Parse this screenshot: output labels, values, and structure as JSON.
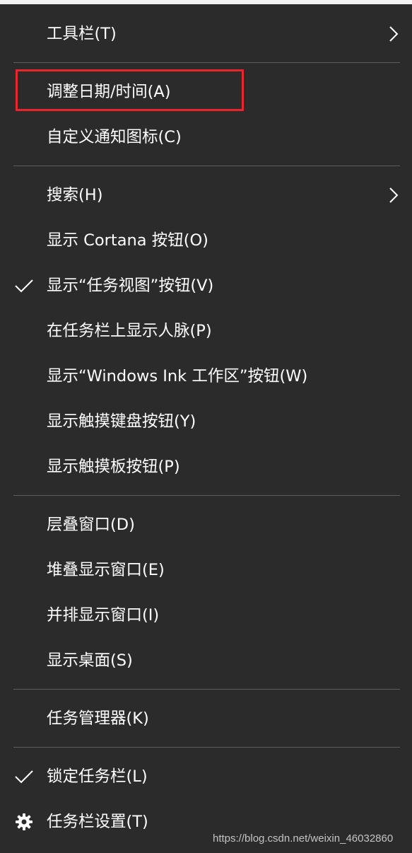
{
  "menu": {
    "items": [
      {
        "label": "工具栏(T)",
        "has_submenu": true,
        "checked": false,
        "icon": ""
      },
      {
        "label": "调整日期/时间(A)",
        "has_submenu": false,
        "checked": false,
        "icon": "",
        "annotated": true
      },
      {
        "label": "自定义通知图标(C)",
        "has_submenu": false,
        "checked": false,
        "icon": ""
      },
      {
        "label": "搜索(H)",
        "has_submenu": true,
        "checked": false,
        "icon": ""
      },
      {
        "label": "显示 Cortana 按钮(O)",
        "has_submenu": false,
        "checked": false,
        "icon": ""
      },
      {
        "label": "显示“任务视图”按钮(V)",
        "has_submenu": false,
        "checked": true,
        "icon": "checkmark-icon"
      },
      {
        "label": "在任务栏上显示人脉(P)",
        "has_submenu": false,
        "checked": false,
        "icon": ""
      },
      {
        "label": "显示“Windows Ink 工作区”按钮(W)",
        "has_submenu": false,
        "checked": false,
        "icon": ""
      },
      {
        "label": "显示触摸键盘按钮(Y)",
        "has_submenu": false,
        "checked": false,
        "icon": ""
      },
      {
        "label": "显示触摸板按钮(P)",
        "has_submenu": false,
        "checked": false,
        "icon": ""
      },
      {
        "label": "层叠窗口(D)",
        "has_submenu": false,
        "checked": false,
        "icon": ""
      },
      {
        "label": "堆叠显示窗口(E)",
        "has_submenu": false,
        "checked": false,
        "icon": ""
      },
      {
        "label": "并排显示窗口(I)",
        "has_submenu": false,
        "checked": false,
        "icon": ""
      },
      {
        "label": "显示桌面(S)",
        "has_submenu": false,
        "checked": false,
        "icon": ""
      },
      {
        "label": "任务管理器(K)",
        "has_submenu": false,
        "checked": false,
        "icon": ""
      },
      {
        "label": "锁定任务栏(L)",
        "has_submenu": false,
        "checked": true,
        "icon": "checkmark-icon"
      },
      {
        "label": "任务栏设置(T)",
        "has_submenu": false,
        "checked": false,
        "icon": "gear-icon"
      }
    ]
  },
  "annotation": {
    "color": "#e8262c",
    "target_item": "调整日期/时间(A)"
  },
  "watermark": "https://blog.csdn.net/weixin_46032860",
  "colors": {
    "menu_background": "#2b2b2b",
    "text": "#ffffff",
    "separator": "#5e5e5e",
    "highlight_border": "#e8262c"
  }
}
